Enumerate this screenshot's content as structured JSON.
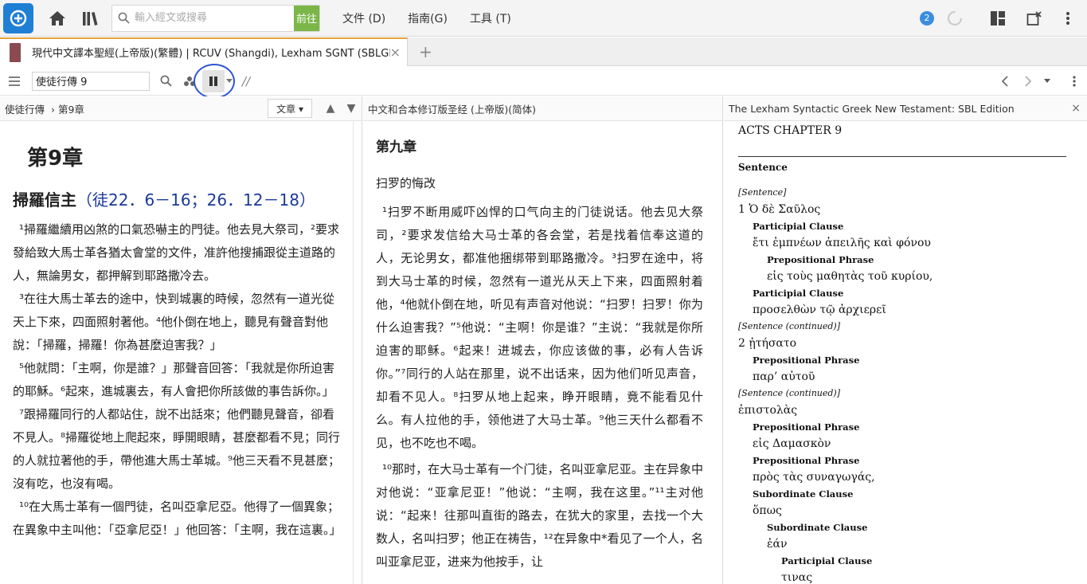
{
  "topbar": {
    "search_placeholder": "輸入經文或搜尋",
    "go_label": "前往",
    "menu": [
      "文件 (D)",
      "指南(G)",
      "工具 (T)"
    ],
    "notification_count": "2"
  },
  "tab": {
    "title": "現代中文譯本聖經(上帝版)(繁體) | RCUV (Shangdi), Lexham SGNT (SBLGNT)",
    "close": "×",
    "new_tab": "+"
  },
  "toolbar": {
    "reference": "使徒行傳 9",
    "sync_mark": "//"
  },
  "pane1": {
    "crumb_book": "使徒行傳",
    "crumb_chapter": "第9章",
    "view_select": "文章 ▾",
    "chapter_title": "第9章",
    "section_title": "掃羅信主",
    "section_xref": "（徒22．6－16；26．12－18）",
    "verses": [
      "¹掃羅繼續用凶煞的口氣恐嚇主的門徒。他去見大祭司，²要求發給致大馬士革各猶太會堂的文件，准許他搜捕跟從主道路的人，無論男女，都押解到耶路撒冷去。",
      "³在往大馬士革去的途中，快到城裏的時候，忽然有一道光從天上下來，四面照射著他。⁴他仆倒在地上，聽見有聲音對他說：「掃羅，掃羅！你為甚麼迫害我？」",
      "⁵他就問：「主啊，你是誰？」那聲音回答：「我就是你所迫害的耶穌。⁶起來，進城裏去，有人會把你所該做的事告訴你。」",
      "⁷跟掃羅同行的人都站住，說不出話來；他們聽見聲音，卻看不見人。⁸掃羅從地上爬起來，睜開眼睛，甚麼都看不見；同行的人就拉著他的手，帶他進大馬士革城。⁹他三天看不見甚麼；沒有吃，也沒有喝。",
      "¹⁰在大馬士革有一個門徒，名叫亞拿尼亞。他得了一個異象；在異象中主叫他：「亞拿尼亞！」他回答：「主啊，我在這裏。」"
    ]
  },
  "pane2": {
    "header": "中文和合本修订版圣经 (上帝版)(简体)",
    "chapter_title": "第九章",
    "section_title": "扫罗的悔改",
    "v1": "¹扫罗不断用威吓凶悍的口气向主的门徒说话。他去见大祭司，²要求发信给大马士革的各会堂，若是找着信奉这道的人，无论男女，都准他捆绑带到耶路撒冷。³扫罗在途中，将到大马士革的时候，忽然有一道光从天上下来，四面照射着他，⁴他就仆倒在地，听见有声音对他说：“扫罗！扫罗！你为什么迫害我？”⁵他说：“主啊！你是谁？”主说：“我就是你所迫害的耶稣。⁶起来！进城去，你应该做的事，必有人告诉你。”⁷同行的人站在那里，说不出话来，因为他们听见声音，却看不见人。⁸扫罗从地上起来，睁开眼睛，竟不能看见什么。有人拉他的手，领他进了大马士革。⁹他三天什么都看不见，也不吃也不喝。",
    "v2": "¹⁰那时，在大马士革有一个门徒，名叫亚拿尼亚。主在异象中对他说：“亚拿尼亚！”他说：“主啊，我在这里。”¹¹主对他说：“起来！往那叫直街的路去，在犹大的家里，去找一个大数人，名叫扫罗；他正在祷告，¹²在异象中*看见了一个人，名叫亚拿尼亚，进来为他按手，让"
  },
  "pane3": {
    "header": "The Lexham Syntactic Greek New Testament: SBL Edition",
    "close": "×",
    "acts": "ACTS CHAPTER 9",
    "sentence_heading": "Sentence",
    "rows": [
      {
        "type": "it",
        "indent": 0,
        "text": "[Sentence]"
      },
      {
        "type": "gk",
        "indent": 0,
        "text": "1 Ὁ δὲ Σαῦλος"
      },
      {
        "type": "lbl",
        "indent": 1,
        "text": "Participial Clause"
      },
      {
        "type": "gk",
        "indent": 1,
        "text": "ἔτι ἐμπνέων ἀπειλῆς καὶ φόνου"
      },
      {
        "type": "lbl",
        "indent": 2,
        "text": "Prepositional Phrase"
      },
      {
        "type": "gk",
        "indent": 2,
        "text": "εἰς τοὺς μαθητὰς τοῦ κυρίου,"
      },
      {
        "type": "lbl",
        "indent": 1,
        "text": "Participial Clause"
      },
      {
        "type": "gk",
        "indent": 1,
        "text": "προσελθὼν τῷ ἀρχιερεῖ"
      },
      {
        "type": "it",
        "indent": 0,
        "text": "[Sentence (continued)]"
      },
      {
        "type": "gk",
        "indent": 0,
        "text": "2 ᾐτήσατο"
      },
      {
        "type": "lbl",
        "indent": 1,
        "text": "Prepositional Phrase"
      },
      {
        "type": "gk",
        "indent": 1,
        "text": "παρ’ αὐτοῦ"
      },
      {
        "type": "it",
        "indent": 0,
        "text": "[Sentence (continued)]"
      },
      {
        "type": "gk",
        "indent": 0,
        "text": "ἐπιστολὰς"
      },
      {
        "type": "lbl",
        "indent": 1,
        "text": "Prepositional Phrase"
      },
      {
        "type": "gk",
        "indent": 1,
        "text": "εἰς Δαμασκὸν"
      },
      {
        "type": "lbl",
        "indent": 1,
        "text": "Prepositional Phrase"
      },
      {
        "type": "gk",
        "indent": 1,
        "text": "πρὸς τὰς συναγωγάς,"
      },
      {
        "type": "lbl",
        "indent": 1,
        "text": "Subordinate Clause"
      },
      {
        "type": "gk",
        "indent": 1,
        "text": "ὅπως"
      },
      {
        "type": "lbl",
        "indent": 2,
        "text": "Subordinate Clause"
      },
      {
        "type": "gk",
        "indent": 2,
        "text": "ἐάν"
      },
      {
        "type": "lbl",
        "indent": 3,
        "text": "Participial Clause"
      },
      {
        "type": "gk",
        "indent": 3,
        "text": "τινας"
      }
    ]
  },
  "colors": {
    "accent_blue": "#1f7fd4",
    "go_green": "#7ab648",
    "tab_accent": "#e8a33b",
    "highlight_circle": "#2f55d4"
  }
}
